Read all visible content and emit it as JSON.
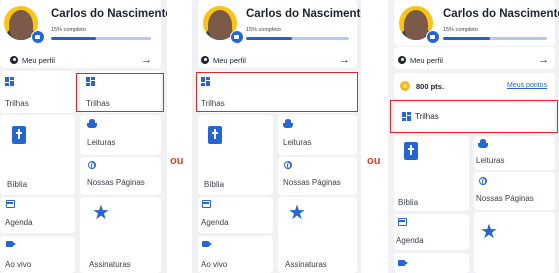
{
  "profile": {
    "name": "Carlos do Nascimento",
    "completion_text": "15% completo",
    "completion_fraction": 0.45,
    "perfil_label": "Meu perfil",
    "arrow": "→"
  },
  "menu": {
    "trilhas": "Trilhas",
    "biblia": "Bíblia",
    "leituras": "Leituras",
    "nossas_paginas": "Nossas Páginas",
    "agenda": "Agenda",
    "ao_vivo": "Ao vivo",
    "assinaturas": "Assinaturas"
  },
  "points": {
    "value": "800 pts.",
    "link": "Meus pontos"
  },
  "separator": "ou",
  "colors": {
    "accent": "#2566d4",
    "highlight": "#e2262b",
    "separator": "#e0442b",
    "background": "#eff1f5"
  },
  "icons": [
    "grid-icon",
    "book-icon",
    "reading-icon",
    "globe-icon",
    "calendar-icon",
    "video-icon",
    "star-icon",
    "coin-icon",
    "camera-icon",
    "person-icon"
  ]
}
